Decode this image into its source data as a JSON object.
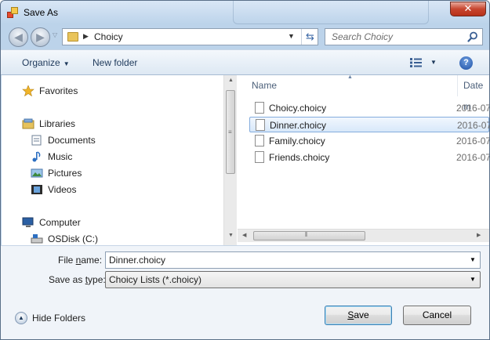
{
  "window": {
    "title": "Save As",
    "close_label": "✕"
  },
  "address": {
    "crumb": "Choicy",
    "search_placeholder": "Search Choicy"
  },
  "toolbar": {
    "organize_label": "Organize",
    "new_folder_label": "New folder"
  },
  "nav": {
    "items": [
      {
        "label": "Favorites",
        "icon": "star-icon"
      },
      {
        "label": "Libraries",
        "icon": "libraries-icon"
      },
      {
        "label": "Documents",
        "icon": "documents-icon"
      },
      {
        "label": "Music",
        "icon": "music-icon"
      },
      {
        "label": "Pictures",
        "icon": "pictures-icon"
      },
      {
        "label": "Videos",
        "icon": "videos-icon"
      },
      {
        "label": "Computer",
        "icon": "computer-icon"
      },
      {
        "label": "OSDisk (C:)",
        "icon": "drive-icon"
      }
    ]
  },
  "files": {
    "columns": {
      "name": "Name",
      "date": "Date m"
    },
    "rows": [
      {
        "name": "Choicy.choicy",
        "date": "2016-07"
      },
      {
        "name": "Dinner.choicy",
        "date": "2016-07"
      },
      {
        "name": "Family.choicy",
        "date": "2016-07"
      },
      {
        "name": "Friends.choicy",
        "date": "2016-07"
      }
    ],
    "selected_index": 1
  },
  "form": {
    "file_name_label_prefix": "File ",
    "file_name_label_accel": "n",
    "file_name_label_suffix": "ame:",
    "file_name_value": "Dinner.choicy",
    "save_type_label_prefix": "Save as ",
    "save_type_label_accel": "t",
    "save_type_label_suffix": "ype:",
    "save_type_value": "Choicy Lists (*.choicy)"
  },
  "buttons": {
    "hide_folders": "Hide Folders",
    "save_accel": "S",
    "save_rest": "ave",
    "cancel": "Cancel"
  },
  "colors": {
    "accent": "#3c7fb1",
    "selection": "#d8e8fa",
    "chrome": "#bcd3ea"
  }
}
